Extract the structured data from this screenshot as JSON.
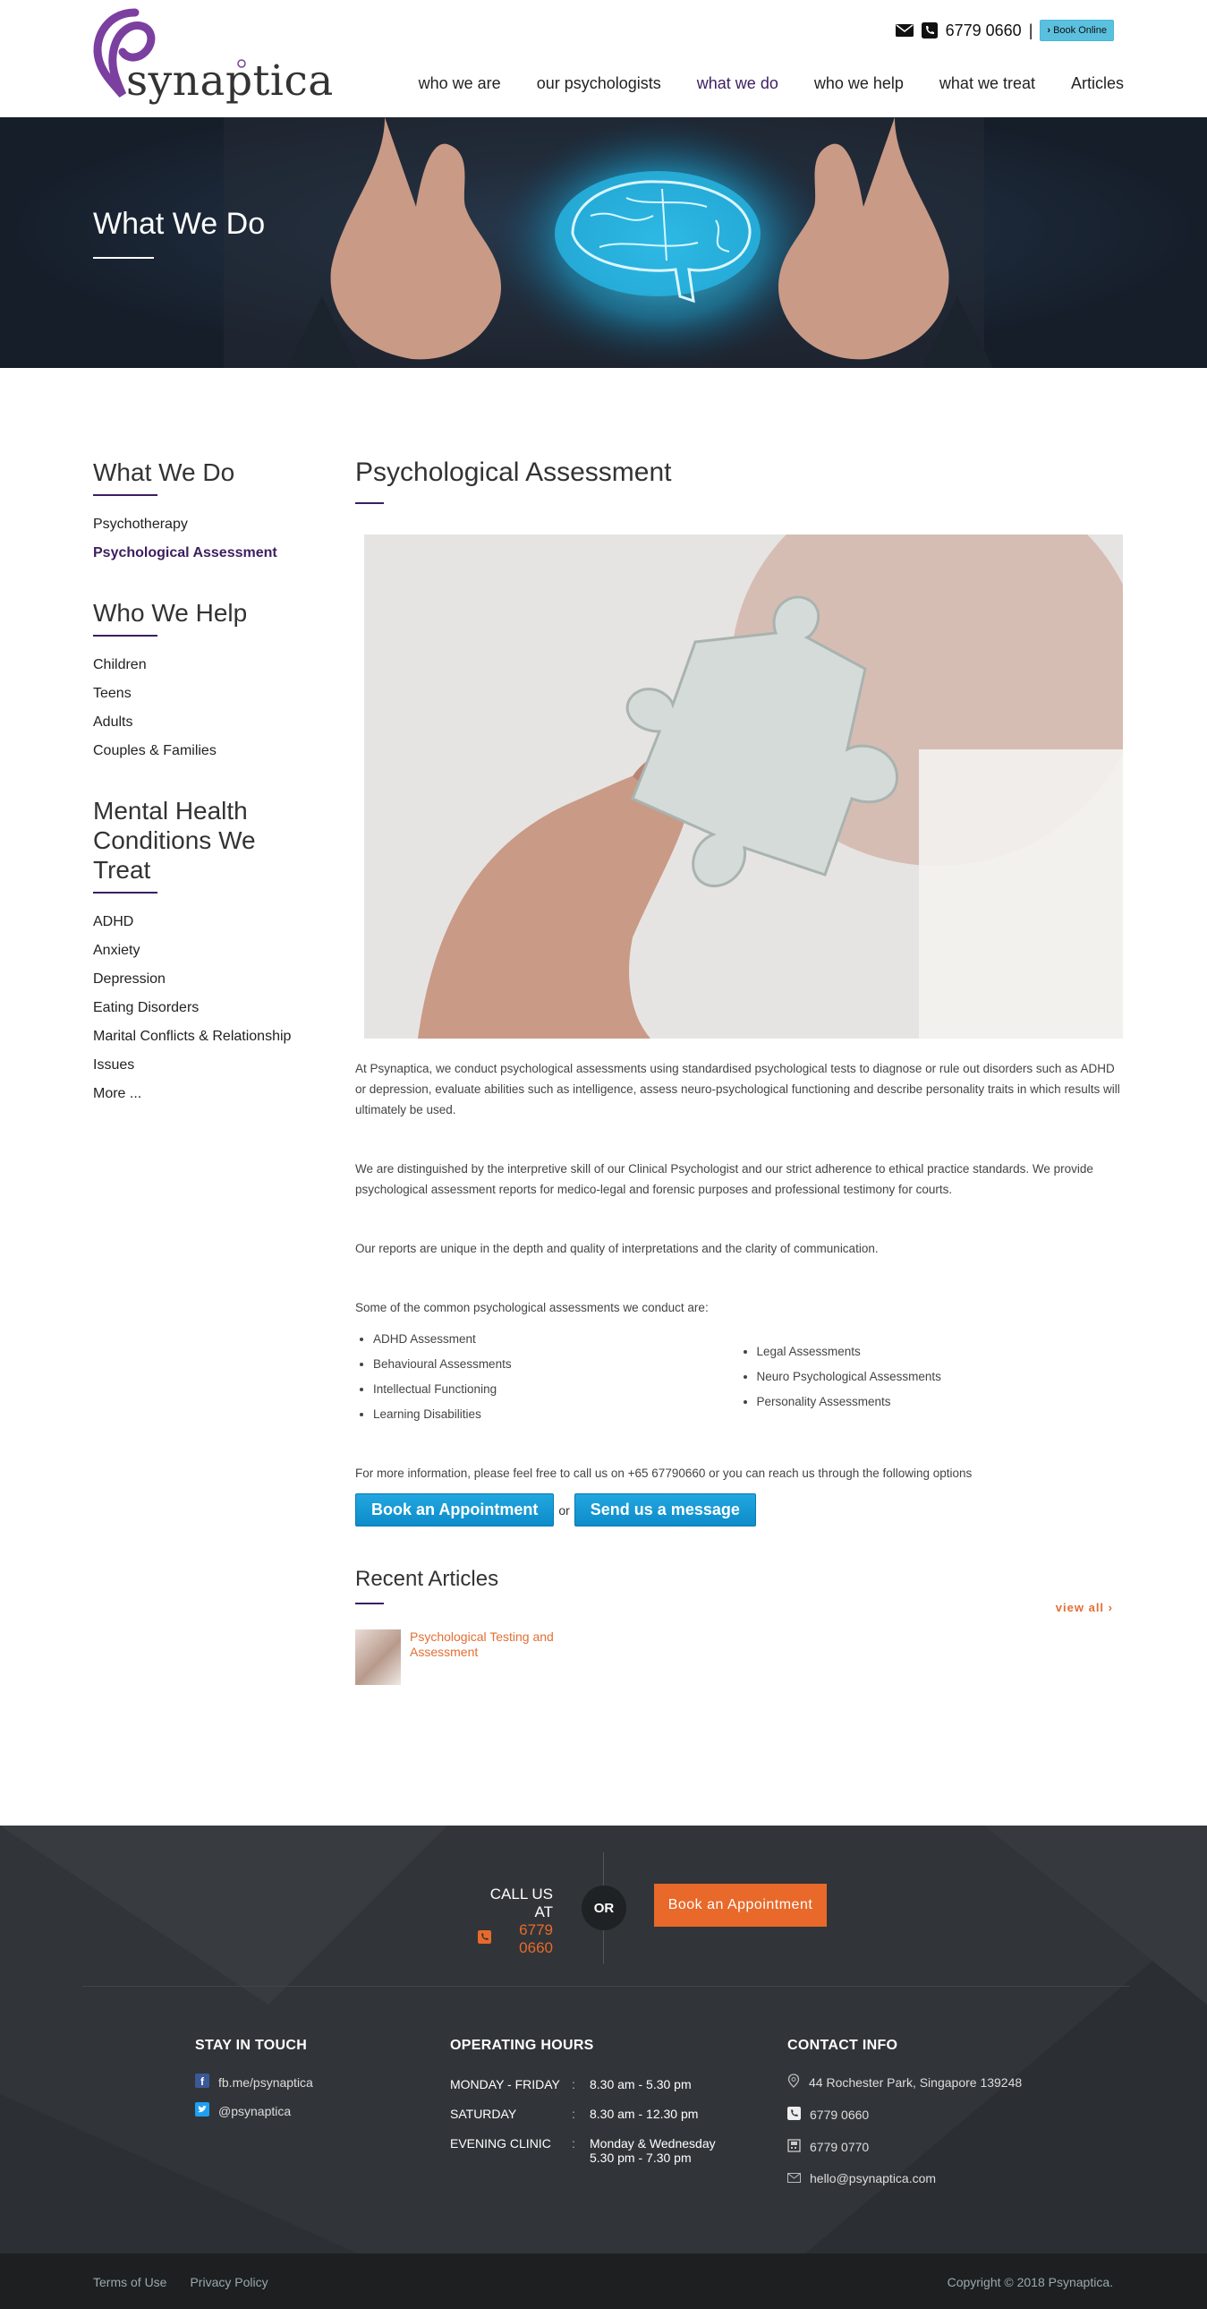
{
  "brand": {
    "name": "psynaptica",
    "accent": "#3c1e5f",
    "logo_color": "#7b3fa0"
  },
  "topbar": {
    "phone": "6779 0660",
    "separator": "|",
    "book_online": "Book Online"
  },
  "nav": [
    {
      "label": "who we are",
      "active": false
    },
    {
      "label": "our psychologists",
      "active": false
    },
    {
      "label": "what we do",
      "active": true
    },
    {
      "label": "who we help",
      "active": false
    },
    {
      "label": "what we treat",
      "active": false
    },
    {
      "label": "Articles",
      "active": false
    }
  ],
  "hero": {
    "title": "What We Do"
  },
  "sidebar": {
    "sections": [
      {
        "heading": "What We Do",
        "items": [
          {
            "label": "Psychotherapy",
            "active": false
          },
          {
            "label": "Psychological Assessment",
            "active": true
          }
        ]
      },
      {
        "heading": "Who We Help",
        "items": [
          {
            "label": "Children"
          },
          {
            "label": "Teens"
          },
          {
            "label": "Adults"
          },
          {
            "label": "Couples & Families"
          }
        ]
      },
      {
        "heading": "Mental Health Conditions We Treat",
        "items": [
          {
            "label": "ADHD"
          },
          {
            "label": "Anxiety"
          },
          {
            "label": "Depression"
          },
          {
            "label": "Eating Disorders"
          },
          {
            "label": "Marital Conflicts & Relationship"
          },
          {
            "label": "Issues"
          },
          {
            "label": "More ..."
          }
        ]
      }
    ]
  },
  "content": {
    "title": "Psychological Assessment",
    "p1": "At Psynaptica, we conduct psychological assessments using standardised psychological tests to diagnose or rule out disorders such as ADHD or depression, evaluate abilities such as intelligence, assess neuro-psychological functioning and describe personality traits in which results will ultimately be used.",
    "p2": "We are distinguished by the interpretive skill of our Clinical Psychologist and our strict adherence to ethical practice standards. We provide psychological assessment reports for medico-legal and forensic purposes and professional testimony for courts.",
    "p3": "Our reports are unique in the depth and quality of interpretations and the clarity of communication.",
    "p4": "Some of the common psychological assessments we conduct are:",
    "list_left": [
      "ADHD Assessment",
      "Behavioural Assessments",
      "Intellectual Functioning",
      "Learning Disabilities"
    ],
    "list_right": [
      "Legal Assessments",
      "Neuro Psychological Assessments",
      "Personality Assessments"
    ],
    "p5": "For more information, please feel free to call us on +65 67790660 or you can reach us through the following options",
    "btn_book": "Book an Appointment",
    "btn_or": "or",
    "btn_message": "Send us a message",
    "recent_title": "Recent Articles",
    "view_all": "view all ›",
    "article_title": "Psychological Testing and Assessment"
  },
  "footer_cta": {
    "call_label": "CALL US AT",
    "phone": "6779 0660",
    "or": "OR",
    "book": "Book an Appointment"
  },
  "footer": {
    "stay": {
      "heading": "STAY IN TOUCH",
      "facebook": "fb.me/psynaptica",
      "twitter": "@psynaptica"
    },
    "hours": {
      "heading": "OPERATING HOURS",
      "rows": [
        {
          "day": "MONDAY - FRIDAY",
          "sep": ":",
          "time": "8.30 am - 5.30 pm"
        },
        {
          "day": "SATURDAY",
          "sep": ":",
          "time": "8.30 am - 12.30 pm"
        },
        {
          "day": "EVENING CLINIC",
          "sep": ":",
          "time": "Monday & Wednesday",
          "time2": "5.30 pm - 7.30 pm"
        }
      ]
    },
    "contact": {
      "heading": "CONTACT INFO",
      "address": "44 Rochester Park, Singapore 139248",
      "phone": "6779 0660",
      "fax": "6779 0770",
      "email": "hello@psynaptica.com"
    }
  },
  "bottom": {
    "terms": "Terms of Use",
    "privacy": "Privacy Policy",
    "copyright": "Copyright © 2018 Psynaptica."
  }
}
